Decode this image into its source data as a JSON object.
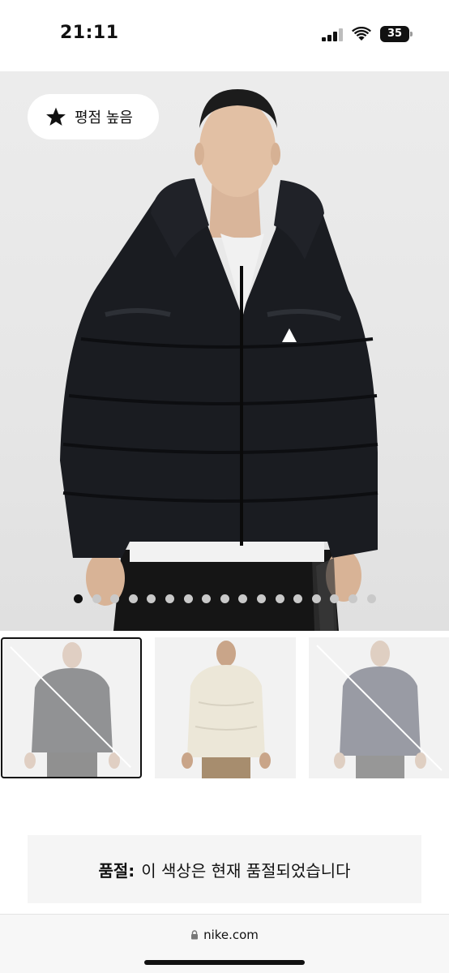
{
  "status_bar": {
    "time": "21:11",
    "battery": "35"
  },
  "hero": {
    "badge_icon": "star-icon",
    "badge_label": "평점 높음",
    "carousel": {
      "total": 17,
      "active_index": 0
    }
  },
  "colors": [
    {
      "name": "black",
      "available": false,
      "selected": true,
      "jacket": "#1b1d22",
      "pants": "#1a1a1a"
    },
    {
      "name": "cream",
      "available": true,
      "selected": false,
      "jacket": "#ece7d8",
      "pants": "#a78d6e"
    },
    {
      "name": "dark-navy",
      "available": false,
      "selected": false,
      "jacket": "#2e3348",
      "pants": "#2a2a2a"
    }
  ],
  "soldout": {
    "label": "품절:",
    "message": "이 색상은 현재 품절되었습니다"
  },
  "browser": {
    "url": "nike.com"
  }
}
